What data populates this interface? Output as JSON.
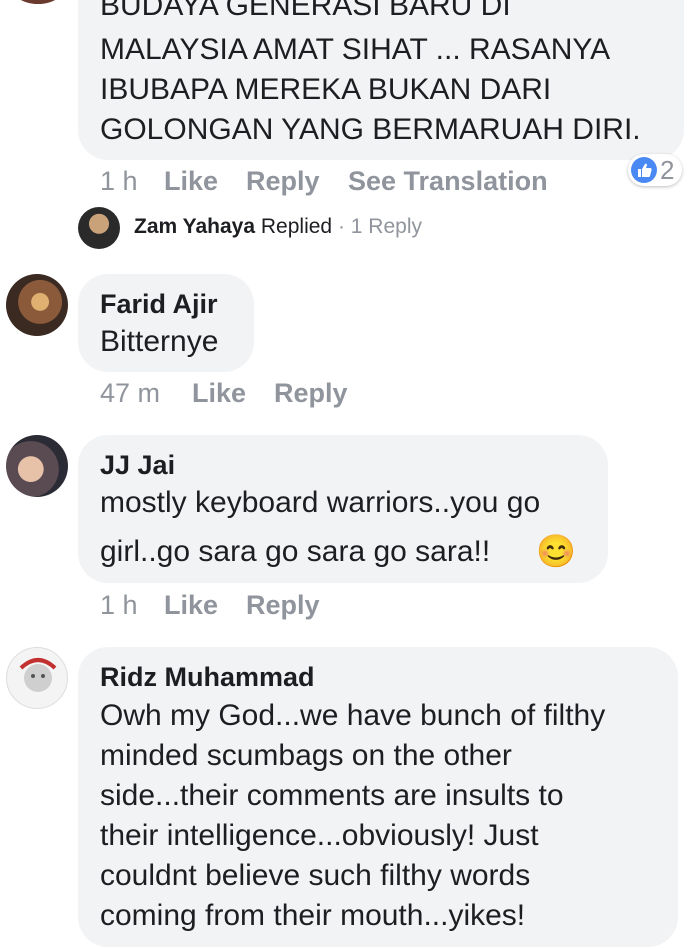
{
  "comments": [
    {
      "author": "",
      "lines": [
        "BUDAYA GENERASI BARU DI",
        "MALAYSIA AMAT SIHAT ... RASANYA",
        "IBUBAPA MEREKA BUKAN DARI",
        "GOLONGAN YANG BERMARUAH DIRI."
      ],
      "time": "1 h",
      "like": "Like",
      "reply": "Reply",
      "translate": "See Translation",
      "reaction_count": "2",
      "reaction_icon": "like-icon"
    },
    {
      "author": "Farid Ajir",
      "lines": [
        "Bitternye"
      ],
      "time": "47 m",
      "like": "Like",
      "reply": "Reply"
    },
    {
      "author": "JJ Jai",
      "lines": [
        "mostly keyboard warriors..you go",
        "girl..go sara go sara go sara!!"
      ],
      "emoji": "😊",
      "time": "1 h",
      "like": "Like",
      "reply": "Reply"
    },
    {
      "author": "Ridz Muhammad",
      "lines": [
        "Owh my God...we have bunch of filthy",
        "minded scumbags on the other",
        "side...their comments are insults to",
        "their intelligence...obviously! Just",
        "couldnt believe such filthy words",
        "coming from their mouth...yikes!"
      ]
    }
  ],
  "reply_summary": {
    "name": "Zam Yahaya",
    "action": "Replied",
    "separator": "·",
    "count": "1 Reply"
  },
  "colors": {
    "bubble": "#f2f3f5",
    "secondary_text": "#90949c",
    "like_blue": "#4a89f3"
  }
}
